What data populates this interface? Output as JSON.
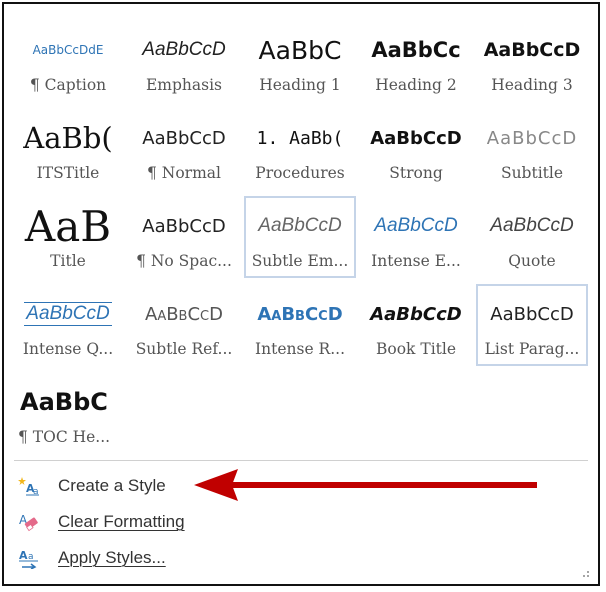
{
  "gallery": {
    "rows": [
      [
        {
          "sample": "AaBbCcDdE",
          "label": "¶ Caption"
        },
        {
          "sample": "AaBbCcD",
          "label": "Emphasis"
        },
        {
          "sample": "AaBbC",
          "label": "Heading 1"
        },
        {
          "sample": "AaBbCc",
          "label": "Heading 2"
        },
        {
          "sample": "AaBbCcD",
          "label": "Heading 3"
        }
      ],
      [
        {
          "sample": "AaBb(",
          "label": "ITSTitle"
        },
        {
          "sample": "AaBbCcD",
          "label": "¶ Normal"
        },
        {
          "sample": "1. AaBb(",
          "label": "Procedures"
        },
        {
          "sample": "AaBbCcD",
          "label": "Strong"
        },
        {
          "sample": "AaBbCcD",
          "label": "Subtitle"
        }
      ],
      [
        {
          "sample": "AaB",
          "label": "Title"
        },
        {
          "sample": "AaBbCcD",
          "label": "¶ No Spac..."
        },
        {
          "sample": "AaBbCcD",
          "label": "Subtle Em..."
        },
        {
          "sample": "AaBbCcD",
          "label": "Intense E..."
        },
        {
          "sample": "AaBbCcD",
          "label": "Quote"
        }
      ],
      [
        {
          "sample": "AaBbCcD",
          "label": "Intense Q..."
        },
        {
          "sample": "AaBbCcD",
          "label": "Subtle Ref..."
        },
        {
          "sample": "AaBbCcD",
          "label": "Intense R..."
        },
        {
          "sample": "AaBbCcD",
          "label": "Book Title"
        },
        {
          "sample": "AaBbCcD",
          "label": "List Parag..."
        }
      ],
      [
        {
          "sample": "AaBbC",
          "label": "¶ TOC He..."
        }
      ]
    ]
  },
  "menu": {
    "create_style": "Create a Style",
    "clear_formatting": "Clear Formatting",
    "apply_styles": "Apply Styles..."
  },
  "colors": {
    "accent": "#2e74b5",
    "selection_border": "#c5d4e8",
    "arrow": "#c00000"
  }
}
